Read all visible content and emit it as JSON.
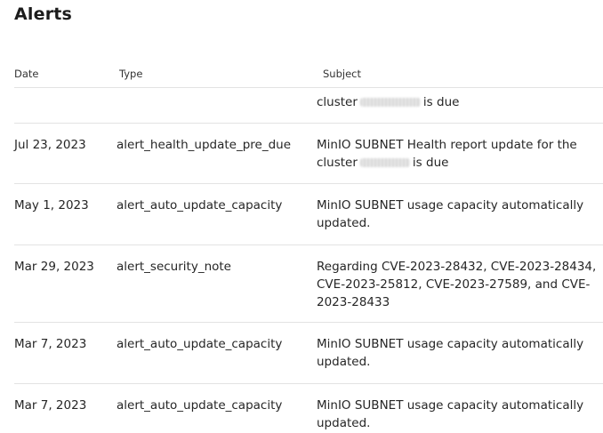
{
  "page": {
    "title": "Alerts"
  },
  "table": {
    "headers": {
      "date": "Date",
      "type": "Type",
      "subject": "Subject"
    },
    "rows": [
      {
        "date": "",
        "type": "",
        "subject_prefix": "cluster",
        "subject_suffix": "is due",
        "redacted": true
      },
      {
        "date": "Jul 23, 2023",
        "type": "alert_health_update_pre_due",
        "subject_prefix": "MinIO SUBNET Health report update for the cluster",
        "subject_suffix": "is due",
        "redacted": true
      },
      {
        "date": "May 1, 2023",
        "type": "alert_auto_update_capacity",
        "subject": "MinIO SUBNET usage capacity automatically updated."
      },
      {
        "date": "Mar 29, 2023",
        "type": "alert_security_note",
        "subject": "Regarding CVE-2023-28432, CVE-2023-28434, CVE-2023-25812, CVE-2023-27589, and CVE-2023-28433"
      },
      {
        "date": "Mar 7, 2023",
        "type": "alert_auto_update_capacity",
        "subject": "MinIO SUBNET usage capacity automatically updated."
      },
      {
        "date": "Mar 7, 2023",
        "type": "alert_auto_update_capacity",
        "subject": "MinIO SUBNET usage capacity automatically updated."
      }
    ]
  }
}
